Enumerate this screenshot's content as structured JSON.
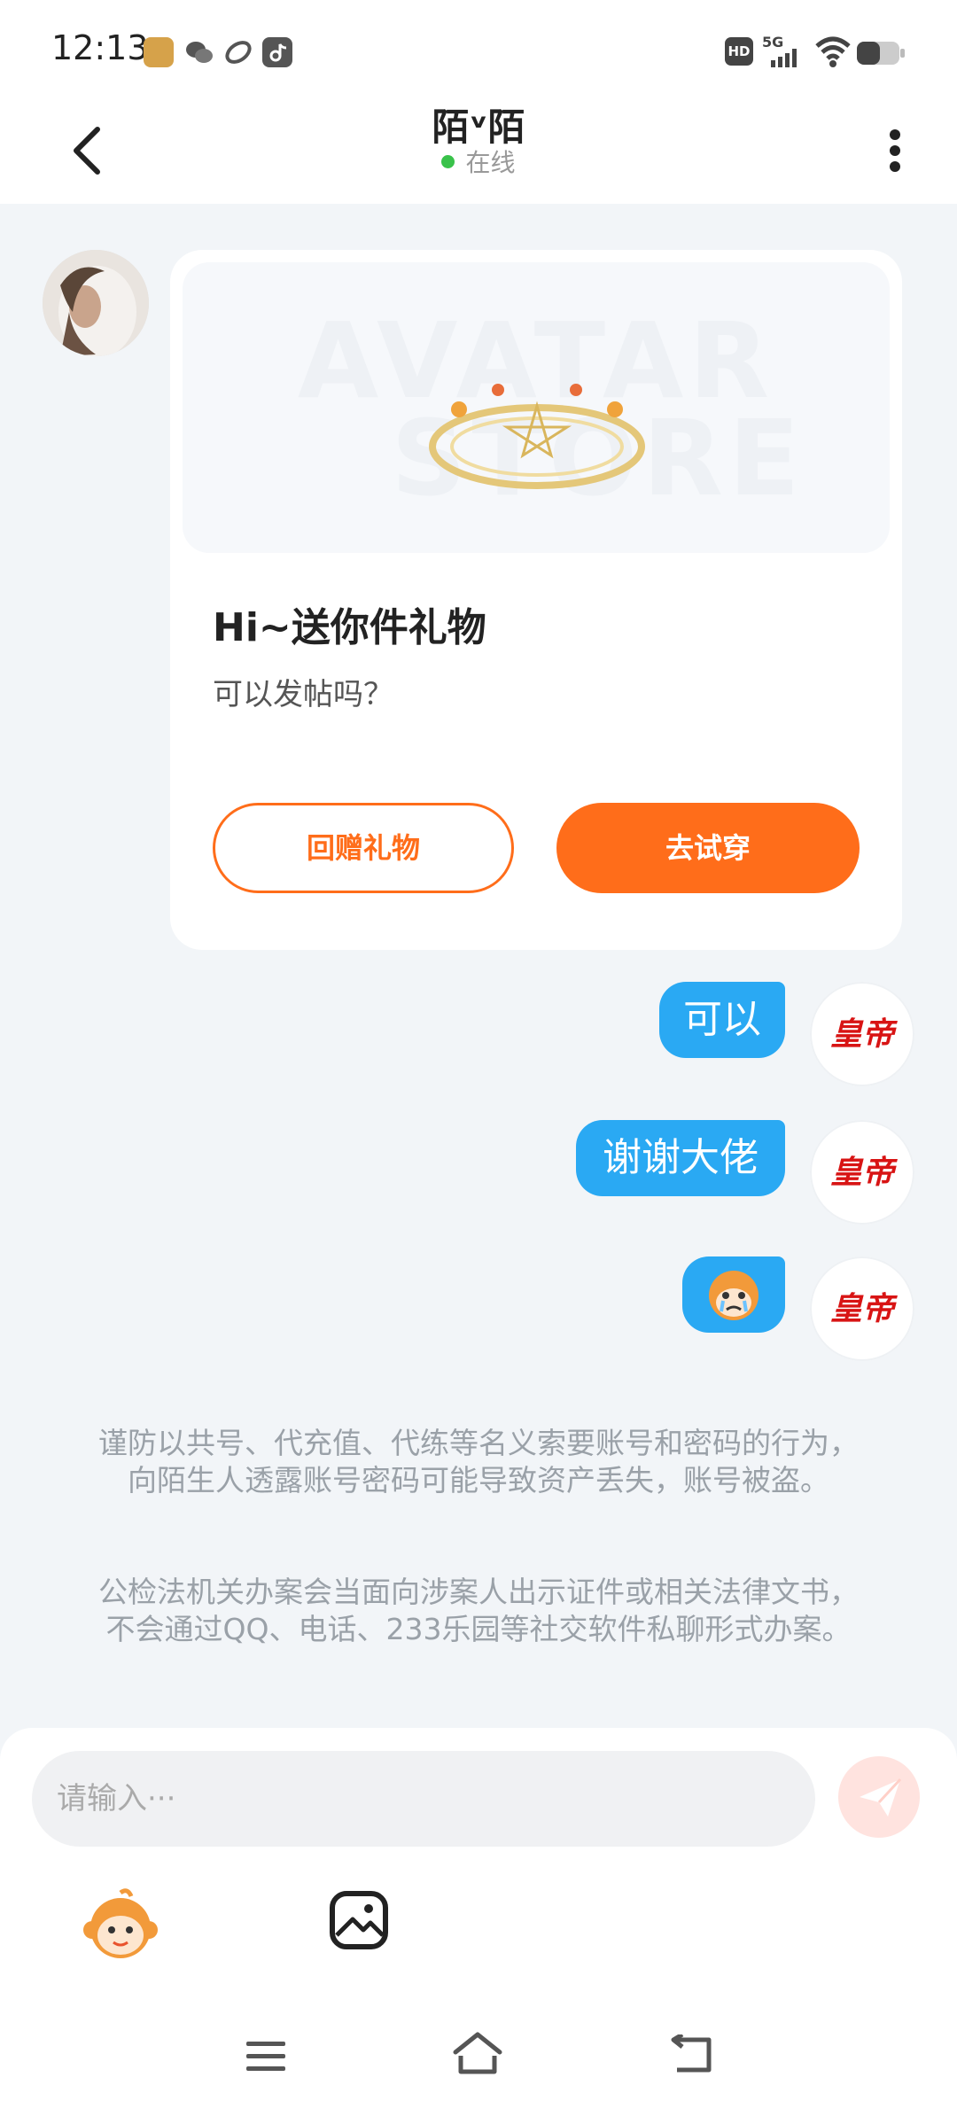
{
  "status_bar": {
    "time": "12:13",
    "app_icons": [
      "game-icon",
      "wechat-icon",
      "app-icon",
      "tiktok-icon"
    ],
    "right_icons": [
      "hd-icon",
      "5g-signal-icon",
      "wifi-icon",
      "battery-icon"
    ],
    "hd_label": "HD",
    "network_label": "5G"
  },
  "header": {
    "title": "陌ᵛ陌",
    "status": "在线",
    "status_color": "#39c24a"
  },
  "gift_card": {
    "watermark_line1": "AVATAR",
    "watermark_line2": "STORE",
    "title": "Hi~送你件礼物",
    "subtitle": "可以发帖吗？",
    "return_gift_label": "回赠礼物",
    "try_on_label": "去试穿"
  },
  "messages": [
    {
      "text": "可以"
    },
    {
      "text": "谢谢大佬"
    },
    {
      "sticker": "crying-monkey-sticker"
    }
  ],
  "my_avatar_text": "皇帝",
  "notices": [
    "谨防以共号、代充值、代练等名义索要账号和密码的行为，向陌生人透露账号密码可能导致资产丢失，账号被盗。",
    "公检法机关办案会当面向涉案人出示证件或相关法律文书，不会通过QQ、电话、233乐园等社交软件私聊形式办案。"
  ],
  "input": {
    "placeholder": "请输入···"
  },
  "colors": {
    "accent": "#ff6d1a",
    "bubble": "#2aa9f3",
    "background": "#f2f5f8"
  }
}
